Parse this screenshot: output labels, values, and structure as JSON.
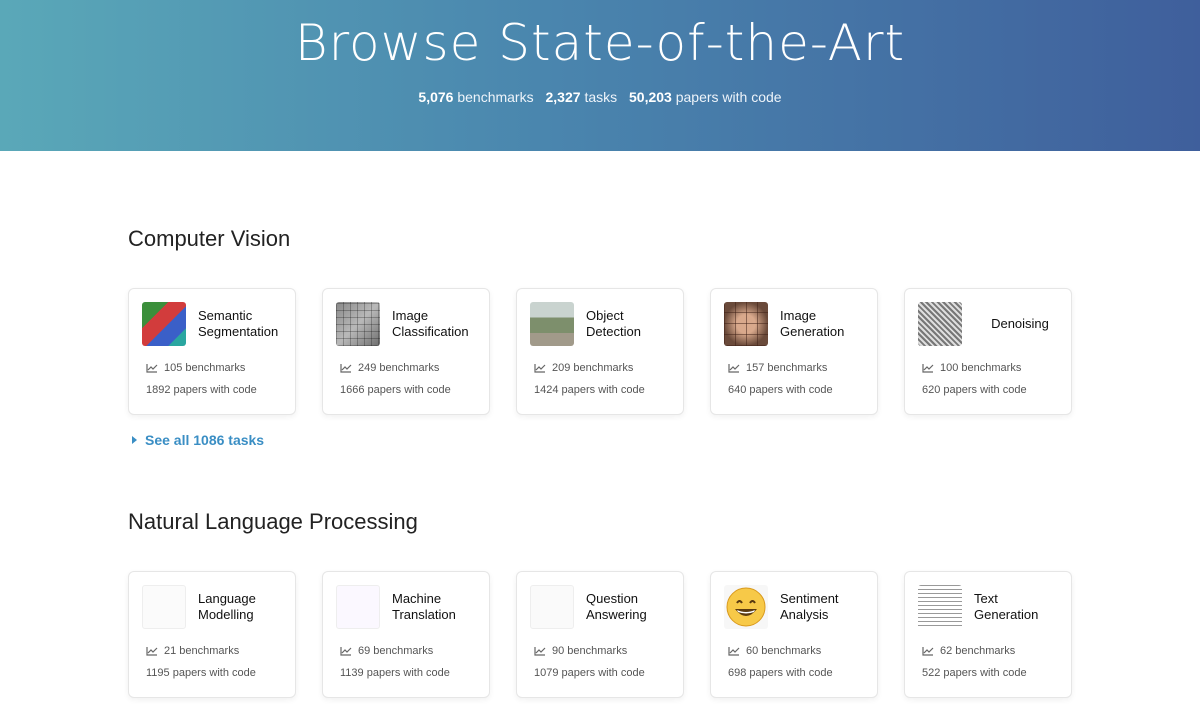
{
  "hero": {
    "title": "Browse State-of-the-Art",
    "stats": [
      {
        "value": "5,076",
        "label": "benchmarks"
      },
      {
        "value": "2,327",
        "label": "tasks"
      },
      {
        "value": "50,203",
        "label": "papers with code"
      }
    ]
  },
  "sections": [
    {
      "title": "Computer Vision",
      "see_all": "See all 1086 tasks",
      "cards": [
        {
          "title_1": "Semantic",
          "title_2": "Segmentation",
          "benchmarks": "105 benchmarks",
          "papers": "1892 papers with code"
        },
        {
          "title_1": "Image",
          "title_2": "Classification",
          "benchmarks": "249 benchmarks",
          "papers": "1666 papers with code"
        },
        {
          "title_1": "Object",
          "title_2": "Detection",
          "benchmarks": "209 benchmarks",
          "papers": "1424 papers with code"
        },
        {
          "title_1": "Image",
          "title_2": "Generation",
          "benchmarks": "157 benchmarks",
          "papers": "640 papers with code"
        },
        {
          "title_1": "Denoising",
          "title_2": "",
          "benchmarks": "100 benchmarks",
          "papers": "620 papers with code"
        }
      ]
    },
    {
      "title": "Natural Language Processing",
      "cards": [
        {
          "title_1": "Language",
          "title_2": "Modelling",
          "benchmarks": "21 benchmarks",
          "papers": "1195 papers with code"
        },
        {
          "title_1": "Machine",
          "title_2": "Translation",
          "benchmarks": "69 benchmarks",
          "papers": "1139 papers with code"
        },
        {
          "title_1": "Question",
          "title_2": "Answering",
          "benchmarks": "90 benchmarks",
          "papers": "1079 papers with code"
        },
        {
          "title_1": "Sentiment",
          "title_2": "Analysis",
          "benchmarks": "60 benchmarks",
          "papers": "698 papers with code"
        },
        {
          "title_1": "Text",
          "title_2": "Generation",
          "benchmarks": "62 benchmarks",
          "papers": "522 papers with code"
        }
      ]
    }
  ],
  "icons": {
    "trend": "trend-chart-icon",
    "caret": "caret-right-icon"
  }
}
